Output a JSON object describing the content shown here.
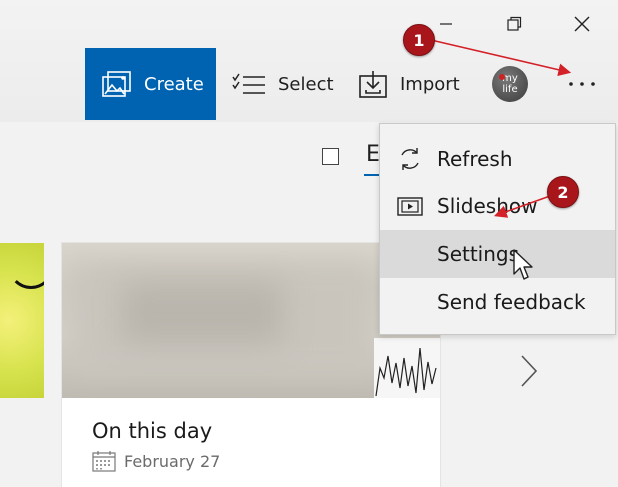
{
  "window_controls": {
    "minimize_icon": "minimize-icon",
    "maximize_icon": "restore-icon",
    "close_icon": "close-icon"
  },
  "toolbar": {
    "create_label": "Create",
    "select_label": "Select",
    "import_label": "Import",
    "avatar_text_line1": "my",
    "avatar_text_line2": "life",
    "more_icon": "more-icon"
  },
  "view": {
    "partial_heading": "E"
  },
  "card": {
    "title": "On this day",
    "date": "February 27"
  },
  "menu": {
    "items": [
      {
        "label": "Refresh",
        "icon": "refresh-icon"
      },
      {
        "label": "Slideshow",
        "icon": "slideshow-icon"
      },
      {
        "label": "Settings",
        "icon": ""
      },
      {
        "label": "Send feedback",
        "icon": ""
      }
    ]
  },
  "annotations": {
    "step1": "1",
    "step2": "2"
  },
  "colors": {
    "accent": "#0063b1",
    "badge": "#a8161b",
    "menu_hover": "#dadada"
  }
}
